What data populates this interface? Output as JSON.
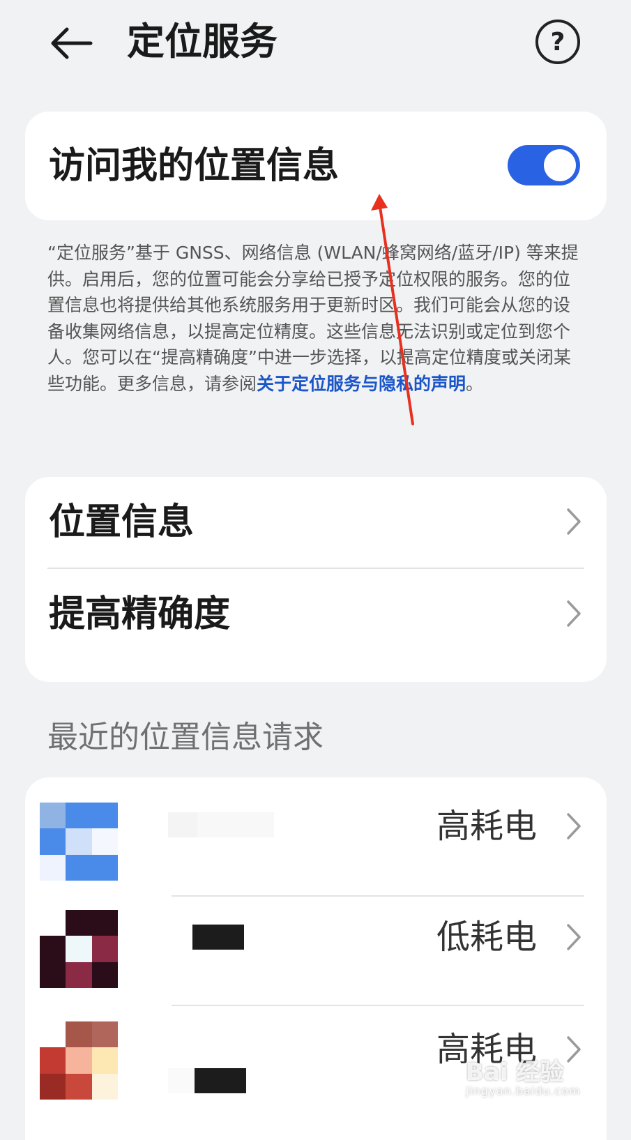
{
  "header": {
    "title": "定位服务",
    "back_icon": "arrow-left-icon",
    "help_label": "?"
  },
  "location_toggle": {
    "label": "访问我的位置信息",
    "state": "on",
    "accent": "#2962e3"
  },
  "description": {
    "text": "“定位服务”基于 GNSS、网络信息 (WLAN/蜂窝网络/蓝牙/IP) 等来提供。启用后，您的位置可能会分享给已授予定位权限的服务。您的位置信息也将提供给其他系统服务用于更新时区。我们可能会从您的设备收集网络信息，以提高定位精度。这些信息无法识别或定位到您个人。您可以在“提高精确度”中进一步选择，以提高定位精度或关闭某些功能。更多信息，请参阅",
    "link": "关于定位服务与隐私的声明",
    "tail": "。"
  },
  "menu": {
    "items": [
      {
        "label": "位置信息"
      },
      {
        "label": "提高精确度"
      }
    ]
  },
  "recent": {
    "title": "最近的位置信息请求",
    "apps": [
      {
        "status": "高耗电"
      },
      {
        "status": "低耗电"
      },
      {
        "status": "高耗电"
      }
    ]
  },
  "watermark": {
    "brand": "Bai 经验",
    "url": "jingyan.baidu.com"
  }
}
